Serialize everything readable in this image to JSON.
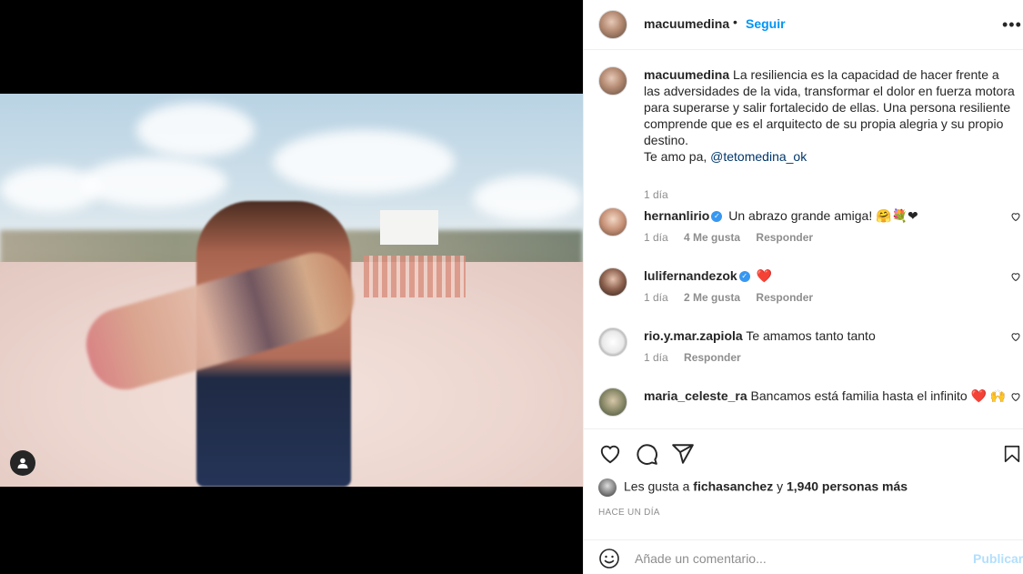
{
  "post": {
    "author": "macuumedina",
    "follow_label": "Seguir",
    "header_separator": "•",
    "more_label": "•••",
    "caption": {
      "username": "macuumedina",
      "text": "La resiliencia es la capacidad de hacer frente a las adversidades de la vida, transformar el dolor en fuerza motora para superarse y salir fortalecido de ellas. Una persona resiliente comprende que es el arquitecto de su propia alegria y su propio destino.",
      "closing": "Te amo pa,",
      "mention": "@tetomedina_ok",
      "time": "1 día"
    },
    "comments": [
      {
        "username": "hernanlirio",
        "verified": true,
        "text": "Un abrazo grande amiga! 🤗💐❤",
        "time": "1 día",
        "likes": "4 Me gusta",
        "reply": "Responder"
      },
      {
        "username": "lulifernandezok",
        "verified": true,
        "text": "❤️",
        "time": "1 día",
        "likes": "2 Me gusta",
        "reply": "Responder"
      },
      {
        "username": "rio.y.mar.zapiola",
        "verified": false,
        "text": "Te amamos tanto tanto",
        "time": "1 día",
        "likes": "",
        "reply": "Responder"
      },
      {
        "username": "maria_celeste_ra",
        "verified": false,
        "text": "Bancamos está familia hasta el infinito ❤️ 🙌",
        "time": "",
        "likes": "",
        "reply": ""
      }
    ],
    "likes_line": {
      "prefix": "Les gusta a",
      "first_user": "fichasanchez",
      "joiner": "y",
      "others": "1,940 personas más"
    },
    "posted_time": "HACE UN DÍA",
    "add_comment": {
      "placeholder": "Añade un comentario...",
      "publish_label": "Publicar"
    }
  },
  "icons": {
    "like": "heart-icon",
    "comment": "comment-icon",
    "share": "share-icon",
    "save": "bookmark-icon",
    "emoji": "emoji-icon",
    "tag": "user-tag-icon",
    "more": "more-icon"
  },
  "colors": {
    "accent": "#0095f6",
    "publish_disabled": "#b2dffc",
    "verified": "#3897f0",
    "secondary_text": "#8e8e8e"
  }
}
